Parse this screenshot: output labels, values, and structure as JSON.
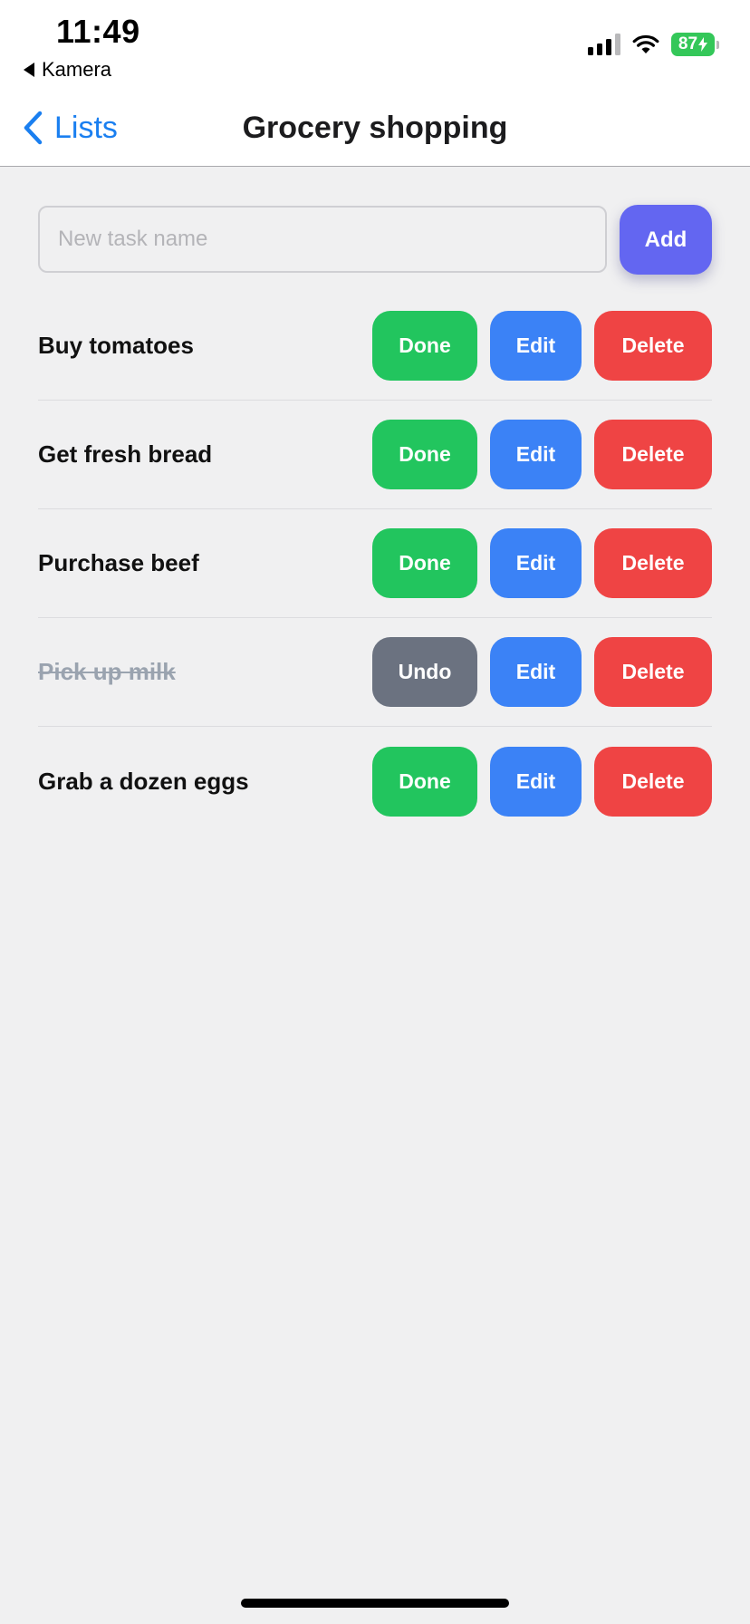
{
  "status_bar": {
    "time": "11:49",
    "back_app": "Kamera",
    "battery": "87",
    "battery_color": "#34c759"
  },
  "nav": {
    "back_label": "Lists",
    "title": "Grocery shopping"
  },
  "new_task": {
    "placeholder": "New task name",
    "value": "",
    "add_label": "Add"
  },
  "tasks": [
    {
      "name": "Buy tomatoes",
      "done": false,
      "toggle_label": "Done",
      "edit_label": "Edit",
      "delete_label": "Delete"
    },
    {
      "name": "Get fresh bread",
      "done": false,
      "toggle_label": "Done",
      "edit_label": "Edit",
      "delete_label": "Delete"
    },
    {
      "name": "Purchase beef",
      "done": false,
      "toggle_label": "Done",
      "edit_label": "Edit",
      "delete_label": "Delete"
    },
    {
      "name": "Pick up milk",
      "done": true,
      "toggle_label": "Undo",
      "edit_label": "Edit",
      "delete_label": "Delete"
    },
    {
      "name": "Grab a dozen eggs",
      "done": false,
      "toggle_label": "Done",
      "edit_label": "Edit",
      "delete_label": "Delete"
    }
  ],
  "colors": {
    "accent_link": "#1a7ff0",
    "add_button": "#6366f1",
    "done_button": "#22c55e",
    "undo_button": "#6b7280",
    "edit_button": "#3b82f6",
    "delete_button": "#ef4444",
    "done_text": "#9aa3af"
  }
}
